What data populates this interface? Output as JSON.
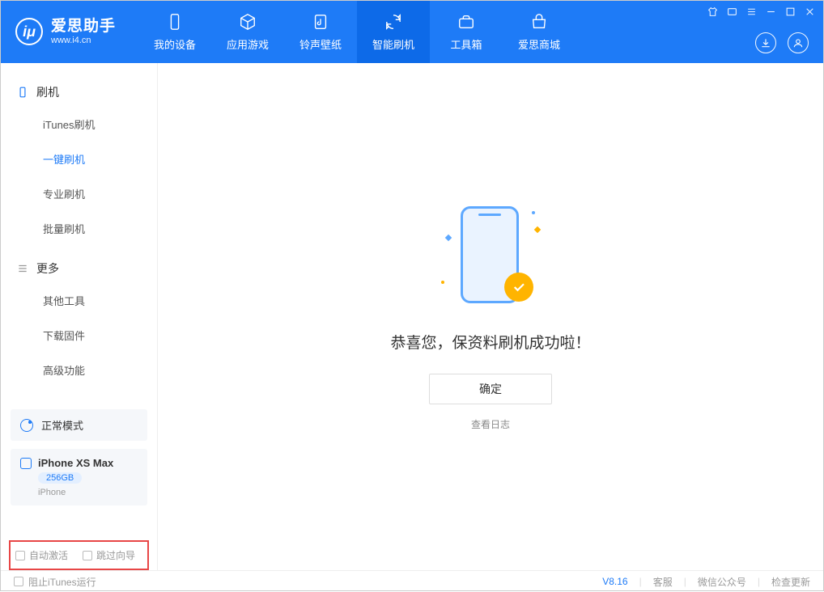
{
  "app": {
    "name": "爱思助手",
    "url": "www.i4.cn"
  },
  "nav": {
    "tabs": [
      {
        "label": "我的设备"
      },
      {
        "label": "应用游戏"
      },
      {
        "label": "铃声壁纸"
      },
      {
        "label": "智能刷机"
      },
      {
        "label": "工具箱"
      },
      {
        "label": "爱思商城"
      }
    ]
  },
  "sidebar": {
    "section1": {
      "title": "刷机"
    },
    "items1": [
      {
        "label": "iTunes刷机"
      },
      {
        "label": "一键刷机"
      },
      {
        "label": "专业刷机"
      },
      {
        "label": "批量刷机"
      }
    ],
    "section2": {
      "title": "更多"
    },
    "items2": [
      {
        "label": "其他工具"
      },
      {
        "label": "下载固件"
      },
      {
        "label": "高级功能"
      }
    ],
    "mode": "正常模式",
    "device": {
      "name": "iPhone XS Max",
      "storage": "256GB",
      "type": "iPhone"
    },
    "options": {
      "auto_activate": "自动激活",
      "skip_guide": "跳过向导"
    }
  },
  "main": {
    "success_title": "恭喜您，保资料刷机成功啦！",
    "confirm": "确定",
    "view_log": "查看日志"
  },
  "footer": {
    "block_itunes": "阻止iTunes运行",
    "version": "V8.16",
    "support": "客服",
    "wechat": "微信公众号",
    "check_update": "检查更新"
  }
}
